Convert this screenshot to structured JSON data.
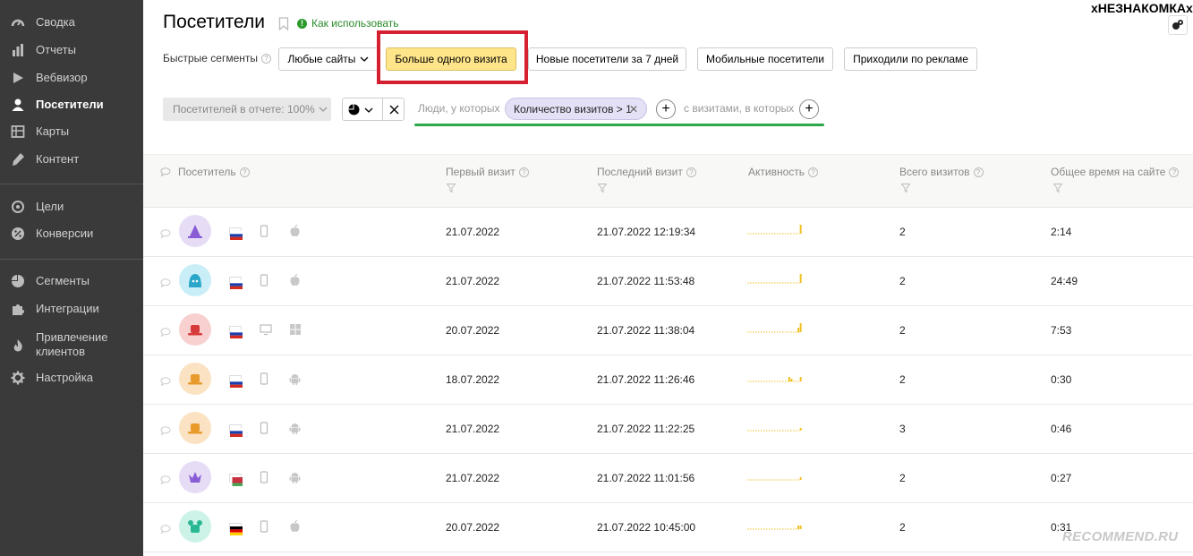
{
  "sidebar": {
    "items": [
      {
        "label": "Сводка",
        "icon": "summary-gauge-icon"
      },
      {
        "label": "Отчеты",
        "icon": "reports-bars-icon"
      },
      {
        "label": "Вебвизор",
        "icon": "play-icon"
      },
      {
        "label": "Посетители",
        "icon": "user-icon",
        "active": true
      },
      {
        "label": "Карты",
        "icon": "map-icon"
      },
      {
        "label": "Контент",
        "icon": "pencil-icon"
      },
      {
        "label": "Цели",
        "icon": "target-icon"
      },
      {
        "label": "Конверсии",
        "icon": "percent-icon"
      },
      {
        "label": "Сегменты",
        "icon": "pie-icon"
      },
      {
        "label": "Интеграции",
        "icon": "puzzle-icon"
      },
      {
        "label_line1": "Привлечение",
        "label_line2": "клиентов",
        "icon": "flame-icon"
      },
      {
        "label": "Настройка",
        "icon": "gear-icon"
      }
    ]
  },
  "header": {
    "title": "Посетители",
    "howto": "Как использовать",
    "username": "хНЕЗНАКОМКАх"
  },
  "quick_segments": {
    "label": "Быстрые сегменты",
    "buttons": [
      "Любые сайты",
      "Больше одного визита",
      "Новые посетители за 7 дней",
      "Мобильные посетители",
      "Приходили по рекламе"
    ],
    "active_index": 1
  },
  "filters": {
    "visitors_in_report": "Посетителей в отчете: 100%",
    "people_label": "Люди, у которых",
    "chip": "Количество визитов > 1",
    "visits_label": "с визитами, в которых"
  },
  "table": {
    "columns": [
      "Посетитель",
      "Первый визит",
      "Последний визит",
      "Активность",
      "Всего визитов",
      "Общее время на сайте"
    ],
    "rows": [
      {
        "first": "21.07.2022",
        "last": "21.07.2022 12:19:34",
        "total": "2",
        "time": "2:14",
        "avatar_color": "#e6dcf5",
        "avatar_fg": "#8a5cd6",
        "avatar_icon": "wizard-hat-icon",
        "flag": "russia",
        "device": "phone-icon",
        "os": "apple-icon",
        "activity": [
          0,
          0,
          0,
          0,
          0,
          0,
          0,
          0,
          0,
          0,
          0,
          0,
          0,
          0,
          0,
          0,
          0,
          0,
          0,
          0,
          0,
          0,
          0,
          1
        ]
      },
      {
        "first": "21.07.2022",
        "last": "21.07.2022 11:53:48",
        "total": "2",
        "time": "24:49",
        "avatar_color": "#c9eef7",
        "avatar_fg": "#2aa6c9",
        "avatar_icon": "hood-icon",
        "flag": "russia",
        "device": "phone-icon",
        "os": "apple-icon",
        "activity": [
          0,
          0,
          0,
          0,
          0,
          0,
          0,
          0,
          0,
          0,
          0,
          0,
          0,
          0,
          0,
          0,
          0,
          0,
          0,
          0,
          0,
          0,
          0,
          1
        ]
      },
      {
        "first": "20.07.2022",
        "last": "21.07.2022 11:38:04",
        "total": "2",
        "time": "7:53",
        "avatar_color": "#f9d0d0",
        "avatar_fg": "#d63a3a",
        "avatar_icon": "hat-icon",
        "flag": "russia",
        "device": "desktop-icon",
        "os": "windows-icon",
        "activity": [
          0,
          0,
          0,
          0,
          0,
          0,
          0,
          0,
          0,
          0,
          0,
          0,
          0,
          0,
          0,
          0,
          0,
          0,
          0,
          0,
          0,
          0,
          0.5,
          1
        ]
      },
      {
        "first": "18.07.2022",
        "last": "21.07.2022 11:26:46",
        "total": "2",
        "time": "0:30",
        "avatar_color": "#fbe2c2",
        "avatar_fg": "#e89a2a",
        "avatar_icon": "hat-icon",
        "flag": "russia",
        "device": "phone-icon",
        "os": "android-icon",
        "activity": [
          0,
          0,
          0,
          0,
          0,
          0,
          0,
          0,
          0,
          0,
          0,
          0,
          0,
          0,
          0,
          0,
          0,
          0,
          0.5,
          0.3,
          0,
          0,
          0,
          0.5
        ]
      },
      {
        "first": "21.07.2022",
        "last": "21.07.2022 11:22:25",
        "total": "3",
        "time": "0:46",
        "avatar_color": "#fbe2c2",
        "avatar_fg": "#e89a2a",
        "avatar_icon": "hat-icon",
        "flag": "russia",
        "device": "phone-icon",
        "os": "android-icon",
        "activity": [
          0,
          0,
          0,
          0,
          0,
          0,
          0,
          0,
          0,
          0,
          0,
          0,
          0,
          0,
          0,
          0,
          0,
          0,
          0,
          0,
          0,
          0,
          0,
          0.3
        ]
      },
      {
        "first": "21.07.2022",
        "last": "21.07.2022 11:01:56",
        "total": "2",
        "time": "0:27",
        "avatar_color": "#e6dcf5",
        "avatar_fg": "#8a5cd6",
        "avatar_icon": "crown-icon",
        "flag": "belarus",
        "device": "phone-icon",
        "os": "android-icon",
        "activity": [
          0,
          0,
          0,
          0,
          0,
          0,
          0,
          0,
          0,
          0,
          0,
          0,
          0,
          0,
          0,
          0,
          0,
          0,
          0,
          0,
          0,
          0,
          0,
          0.3
        ]
      },
      {
        "first": "20.07.2022",
        "last": "21.07.2022 10:45:00",
        "total": "2",
        "time": "0:31",
        "avatar_color": "#cdf3e8",
        "avatar_fg": "#2ab894",
        "avatar_icon": "mouse-ears-icon",
        "flag": "germany",
        "device": "phone-icon",
        "os": "apple-icon",
        "activity": [
          0,
          0,
          0,
          0,
          0,
          0,
          0,
          0,
          0,
          0,
          0,
          0,
          0,
          0,
          0,
          0,
          0,
          0,
          0,
          0,
          0,
          0,
          0.4,
          0.4
        ]
      }
    ]
  },
  "watermark": "RECOMMEND.RU",
  "colors": {
    "sidebar": "#3a3a3a",
    "accent_yellow": "#ffe58a",
    "highlight_red": "#d42030",
    "underline_green": "#2aa84a",
    "activity_bar": "#f0c020"
  }
}
